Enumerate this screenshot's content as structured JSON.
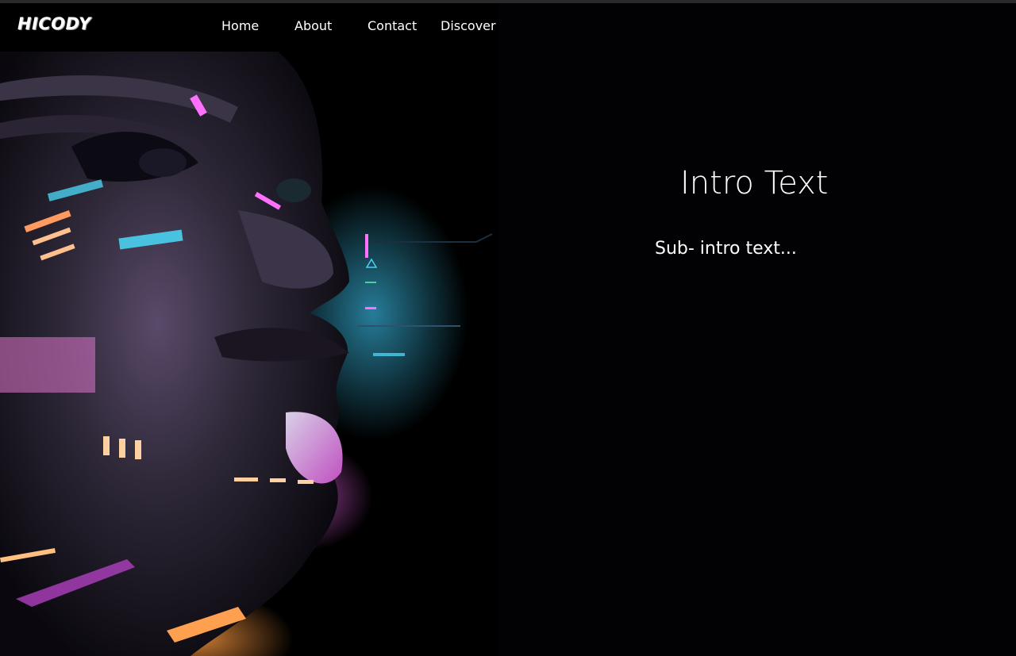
{
  "brand": {
    "logo_text": "HICODY"
  },
  "nav": {
    "items": [
      {
        "label": "Home"
      },
      {
        "label": "About"
      },
      {
        "label": "Contact"
      },
      {
        "label": "Discover"
      }
    ]
  },
  "hero": {
    "title": "Intro Text",
    "subtitle": "Sub- intro text...",
    "image_subject": "futuristic-cyborg-face"
  },
  "colors": {
    "background": "#000000",
    "text": "#ffffff",
    "accent_magenta": "#d04ad8",
    "accent_cyan": "#4ad8f0",
    "accent_orange": "#ffb070"
  }
}
